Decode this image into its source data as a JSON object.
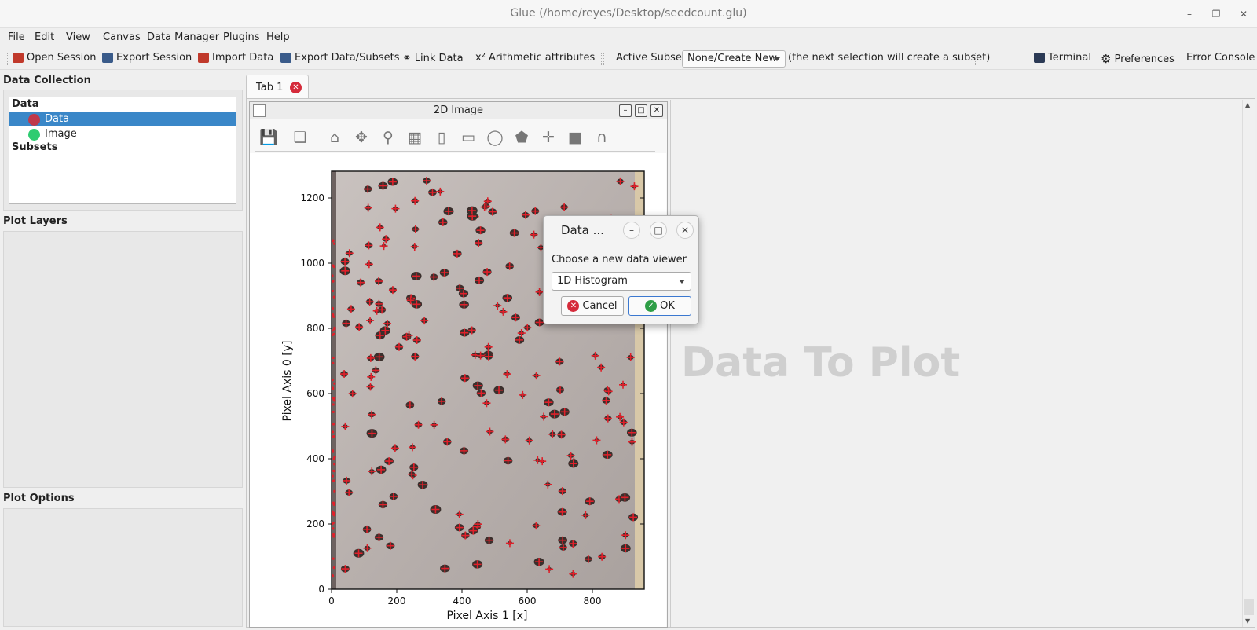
{
  "window": {
    "title": "Glue (/home/reyes/Desktop/seedcount.glu)"
  },
  "menu": [
    "File",
    "Edit",
    "View",
    "Canvas",
    "Data Manager",
    "Plugins",
    "Help"
  ],
  "toolbar": {
    "open_session": "Open Session",
    "export_session": "Export Session",
    "import_data": "Import Data",
    "export_data": "Export Data/Subsets",
    "link_data": "Link Data",
    "arithmetic": "Arithmetic attributes",
    "arithmetic_prefix": "x²",
    "active_subset_label": "Active Subset:",
    "active_subset_value": "None/Create New",
    "subset_hint": "(the next selection will create a subset)",
    "terminal": "Terminal",
    "preferences": "Preferences",
    "error_console": "Error Console"
  },
  "data_collection": {
    "title": "Data Collection",
    "data_header": "Data",
    "items": [
      {
        "label": "Data",
        "color": "#c0394b",
        "selected": true
      },
      {
        "label": "Image",
        "color": "#2ecc71",
        "selected": false
      }
    ],
    "subsets_header": "Subsets"
  },
  "plot_layers": {
    "title": "Plot Layers"
  },
  "plot_options": {
    "title": "Plot Options"
  },
  "tabs": [
    {
      "label": "Tab 1"
    }
  ],
  "viewer": {
    "title": "2D Image",
    "plot": {
      "xlabel": "Pixel Axis 1 [x]",
      "ylabel": "Pixel Axis 0 [y]",
      "xticks": [
        "0",
        "200",
        "400",
        "600",
        "800"
      ],
      "yticks": [
        "0",
        "200",
        "400",
        "600",
        "800",
        "1000",
        "1200"
      ]
    }
  },
  "watermark": "Data To Plot",
  "dialog": {
    "title": "Data ...",
    "prompt": "Choose a new data viewer",
    "selected_viewer": "1D Histogram",
    "cancel": "Cancel",
    "ok": "OK"
  }
}
